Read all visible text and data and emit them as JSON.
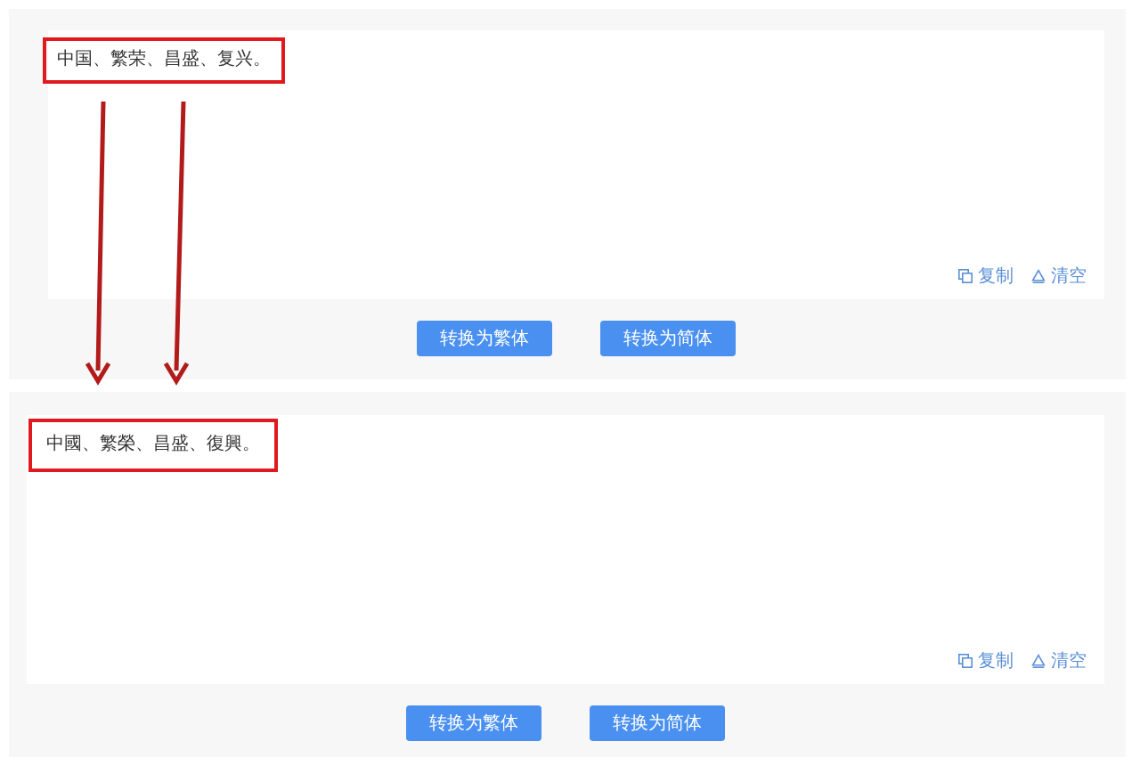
{
  "panels": [
    {
      "text": "中国、繁荣、昌盛、复兴。",
      "highlighted": true,
      "tools": [
        "复制",
        "清空"
      ],
      "buttons": [
        "转换为繁体",
        "转换为简体"
      ]
    },
    {
      "text": "中國、繁榮、昌盛、復興。",
      "highlighted": true,
      "tools": [
        "复制",
        "清空"
      ],
      "buttons": [
        "转换为繁体",
        "转换为简体"
      ]
    }
  ]
}
